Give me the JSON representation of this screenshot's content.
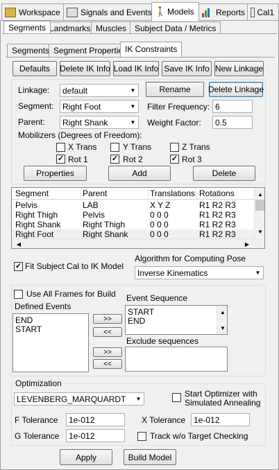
{
  "top_tabs": [
    {
      "label": "Workspace",
      "icon": "workspace-icon"
    },
    {
      "label": "Signals and Events",
      "icon": "signals-icon"
    },
    {
      "label": "Models",
      "icon": "models-icon"
    },
    {
      "label": "Reports",
      "icon": "reports-icon"
    },
    {
      "label": "Cal1",
      "icon": "cal-icon"
    }
  ],
  "sub_tabs": [
    "Segments",
    "Landmarks",
    "Muscles",
    "Subject Data / Metrics"
  ],
  "inner_tabs": [
    "Segments",
    "Segment Properties",
    "IK Constraints"
  ],
  "toolbar": [
    "Defaults",
    "Delete IK Info",
    "Load IK Info",
    "Save IK Info",
    "New Linkage"
  ],
  "form": {
    "linkage_label": "Linkage:",
    "linkage_value": "default",
    "rename": "Rename",
    "delete_linkage": "Delete Linkage",
    "segment_label": "Segment:",
    "segment_value": "Right Foot",
    "filter_label": "Filter Frequency:",
    "filter_value": "6",
    "parent_label": "Parent:",
    "parent_value": "Right Shank",
    "weight_label": "Weight Factor:",
    "weight_value": "0.5",
    "mobilizers_label": "Mobilizers (Degrees of Freedom):",
    "x_trans": "X Trans",
    "y_trans": "Y Trans",
    "z_trans": "Z Trans",
    "rot1": "Rot 1",
    "rot2": "Rot 2",
    "rot3": "Rot 3",
    "properties": "Properties",
    "add": "Add",
    "delete": "Delete"
  },
  "table": {
    "headers": [
      "Segment",
      "Parent",
      "Translations",
      "Rotations"
    ],
    "rows": [
      [
        "Pelvis",
        "LAB",
        "X  Y  Z",
        "R1  R2  R3"
      ],
      [
        "Right Thigh",
        "Pelvis",
        "0  0  0",
        "R1  R2  R3"
      ],
      [
        "Right Shank",
        "Right Thigh",
        "0  0  0",
        "R1  R2  R3"
      ],
      [
        "Right Foot",
        "Right Shank",
        "0  0  0",
        "R1  R2  R3"
      ]
    ]
  },
  "fit_label": "Fit Subject Cal to IK Model",
  "algo_label": "Algorithm for Computing Pose",
  "algo_value": "Inverse Kinematics",
  "events": {
    "use_all": "Use All Frames for Build",
    "defined_label": "Defined Events",
    "defined": [
      "END",
      "START"
    ],
    "seq_label": "Event Sequence",
    "sequence": [
      "START",
      "END"
    ],
    "exclude_label": "Exclude sequences",
    "add_arrow": ">>",
    "remove_arrow": "<<"
  },
  "optimization": {
    "title": "Optimization",
    "method": "LEVENBERG_MARQUARDT",
    "start_opt": "Start Optimizer with",
    "start_opt2": "Simulated Annealing",
    "f_tol_label": "F Tolerance",
    "f_tol": "1e-012",
    "x_tol_label": "X Tolerance",
    "x_tol": "1e-012",
    "g_tol_label": "G Tolerance",
    "g_tol": "1e-012",
    "track_label": "Track w/o Target Checking"
  },
  "apply": "Apply",
  "build": "Build Model"
}
